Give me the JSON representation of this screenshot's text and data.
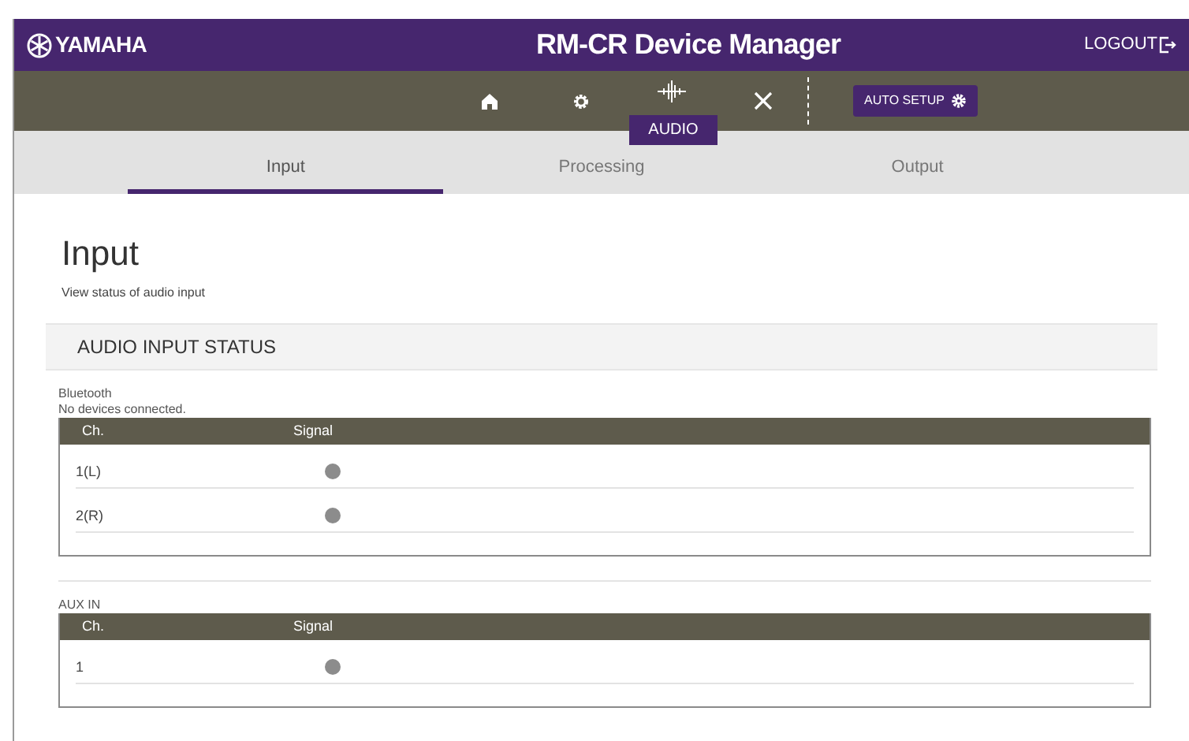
{
  "header": {
    "logo": "YAMAHA",
    "title": "RM-CR Device Manager",
    "logout": "LOGOUT"
  },
  "nav": [
    {
      "kind": "home",
      "selected": false
    },
    {
      "kind": "settings",
      "selected": false
    },
    {
      "kind": "audio",
      "selected": true,
      "label": "AUDIO"
    },
    {
      "kind": "tools",
      "selected": false
    }
  ],
  "auto_setup": "AUTO SETUP",
  "tabs": [
    {
      "label": "Input",
      "selected": true
    },
    {
      "label": "Processing",
      "selected": false
    },
    {
      "label": "Output",
      "selected": false
    }
  ],
  "page": {
    "title": "Input",
    "subtitle": "View status of audio input"
  },
  "section": "AUDIO INPUT STATUS",
  "groups": [
    {
      "name": "Bluetooth",
      "note": "No devices connected.",
      "columns": [
        "Ch.",
        "Signal"
      ],
      "rows": [
        {
          "ch": "1(L)",
          "signal": false
        },
        {
          "ch": "2(R)",
          "signal": false
        }
      ]
    },
    {
      "name": "AUX IN",
      "columns": [
        "Ch.",
        "Signal"
      ],
      "rows": [
        {
          "ch": "1",
          "signal": false
        }
      ]
    }
  ]
}
